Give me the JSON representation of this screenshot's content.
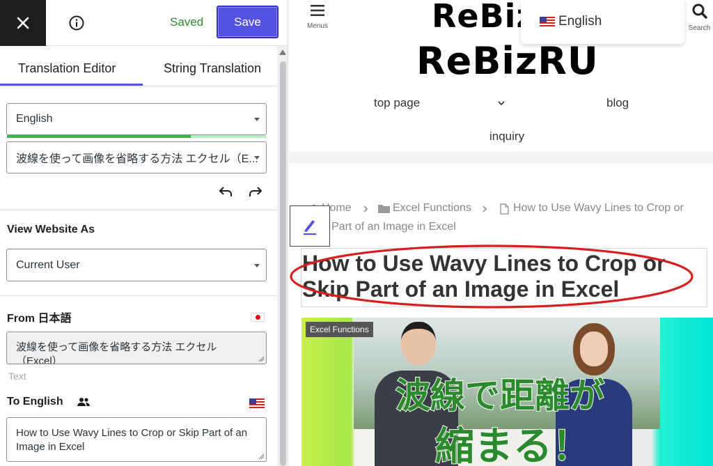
{
  "editor": {
    "saved_label": "Saved",
    "save_label": "Save",
    "tabs": [
      {
        "label": "Translation Editor",
        "active": true
      },
      {
        "label": "String Translation",
        "active": false
      }
    ],
    "language_select": {
      "value": "English",
      "progress_percent": 71
    },
    "string_select": {
      "value": "波線を使って画像を省略する方法 エクセル（E..."
    },
    "view_as": {
      "title": "View Website As",
      "value": "Current User"
    },
    "from": {
      "label": "From 日本語",
      "text": "波線を使って画像を省略する方法 エクセル（Excel）",
      "type_label": "Text"
    },
    "to": {
      "label": "To English",
      "text": "How to Use Wavy Lines to Crop or Skip Part of an Image in Excel"
    },
    "accent_color": "#5352e3"
  },
  "site": {
    "menu_label": "Menus",
    "search_label": "Search",
    "logo_top": "ReBiz",
    "logo": "ReBizRU",
    "language_popup": {
      "label": "English"
    },
    "nav": [
      {
        "label": "top page"
      },
      {
        "label": "blog"
      },
      {
        "label": "inquiry"
      }
    ],
    "breadcrumb": {
      "home": "Home",
      "category": "Excel Functions",
      "current_line1": "How to Use Wavy Lines to Crop or",
      "current_line2": "Part of an Image in Excel"
    },
    "title": "How to Use Wavy Lines to Crop or Skip Part of an Image in Excel",
    "hero": {
      "badge": "Excel Functions",
      "jp_line1": "波線で距離が",
      "jp_line2": "縮まる！"
    },
    "highlight_color": "#d51f1f"
  }
}
